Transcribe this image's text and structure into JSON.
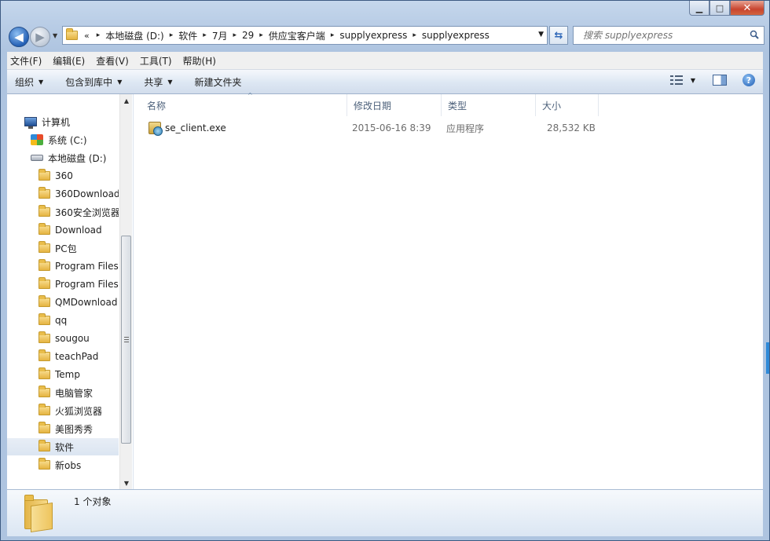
{
  "window": {
    "controls": {
      "minimize": "▁",
      "maximize": "□",
      "close": "✕"
    }
  },
  "nav": {
    "back_glyph": "◀",
    "forward_glyph": "▶",
    "history_glyph": "▼",
    "breadcrumb_overflow": "«",
    "breadcrumb": [
      "本地磁盘 (D:)",
      "软件",
      "7月",
      "29",
      "供应宝客户端",
      "supplyexpress",
      "supplyexpress"
    ],
    "separator": "▸",
    "address_dropdown": "▼",
    "refresh_glyph": "⇆",
    "search_placeholder": "搜索 supplyexpress"
  },
  "menubar": [
    "文件(F)",
    "编辑(E)",
    "查看(V)",
    "工具(T)",
    "帮助(H)"
  ],
  "toolbar": {
    "buttons": [
      {
        "label": "组织",
        "has_menu": true
      },
      {
        "label": "包含到库中",
        "has_menu": true
      },
      {
        "label": "共享",
        "has_menu": true
      },
      {
        "label": "新建文件夹",
        "has_menu": false
      }
    ],
    "menu_arrow": "▼",
    "views_arrow": "▼",
    "help_glyph": "?"
  },
  "tree": {
    "computer": "计算机",
    "drive_c": "系统 (C:)",
    "drive_d": "本地磁盘 (D:)",
    "folders": [
      "360",
      "360Download",
      "360安全浏览器",
      "Download",
      "PC包",
      "Program Files",
      "Program Files",
      "QMDownload",
      "qq",
      "sougou",
      "teachPad",
      "Temp",
      "电脑管家",
      "火狐浏览器",
      "美图秀秀",
      "软件",
      "新obs"
    ],
    "selected": "软件",
    "scroll_up": "▲",
    "scroll_down": "▼"
  },
  "columns": {
    "name": "名称",
    "modified": "修改日期",
    "type": "类型",
    "size": "大小",
    "sort_indicator": "^"
  },
  "files": [
    {
      "name": "se_client.exe",
      "modified": "2015-06-16 8:39",
      "type": "应用程序",
      "size": "28,532 KB"
    }
  ],
  "status": {
    "count_text": "1 个对象"
  }
}
